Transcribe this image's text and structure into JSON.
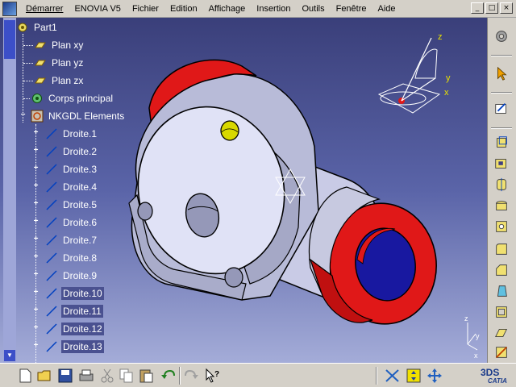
{
  "menubar": {
    "items": [
      "Démarrer",
      "ENOVIA V5",
      "Fichier",
      "Edition",
      "Affichage",
      "Insertion",
      "Outils",
      "Fenêtre",
      "Aide"
    ],
    "window_controls": [
      "_",
      "□",
      "×"
    ]
  },
  "tree": {
    "root": "Part1",
    "planes": [
      "Plan xy",
      "Plan yz",
      "Plan zx"
    ],
    "body": "Corps principal",
    "group": "NKGDL Elements",
    "lines": [
      "Droite.1",
      "Droite.2",
      "Droite.3",
      "Droite.4",
      "Droite.5",
      "Droite.6",
      "Droite.7",
      "Droite.8",
      "Droite.9",
      "Droite.10",
      "Droite.11",
      "Droite.12",
      "Droite.13"
    ]
  },
  "compass": {
    "labels": [
      "z",
      "y",
      "x"
    ]
  },
  "axis_triad": {
    "labels": [
      "z",
      "y",
      "x"
    ]
  },
  "logo": {
    "text": "CATIA",
    "mark": "3DS"
  },
  "colors": {
    "viewport_top": "#3a3f7a",
    "viewport_bottom": "#a4acd8",
    "part_body": "#d8dbf0",
    "flange_red": "#e01818",
    "bore_blue": "#1818a0",
    "highlight_yellow": "#d8d800"
  },
  "toolbars": {
    "right": [
      "settings-icon",
      "select-arrow-icon",
      "sketcher-icon",
      "pad-icon",
      "pocket-icon",
      "shaft-icon",
      "hole-icon",
      "rib-icon",
      "fillet-icon",
      "chamfer-icon",
      "draft-icon",
      "shell-icon",
      "thickness-icon",
      "thread-icon"
    ],
    "bottom": [
      "new-icon",
      "open-icon",
      "save-icon",
      "print-icon",
      "cut-icon",
      "copy-icon",
      "paste-icon",
      "undo-icon",
      "redo-icon",
      "whats-this-icon",
      "fly-mode-icon",
      "fit-all-icon",
      "pan-icon"
    ]
  }
}
